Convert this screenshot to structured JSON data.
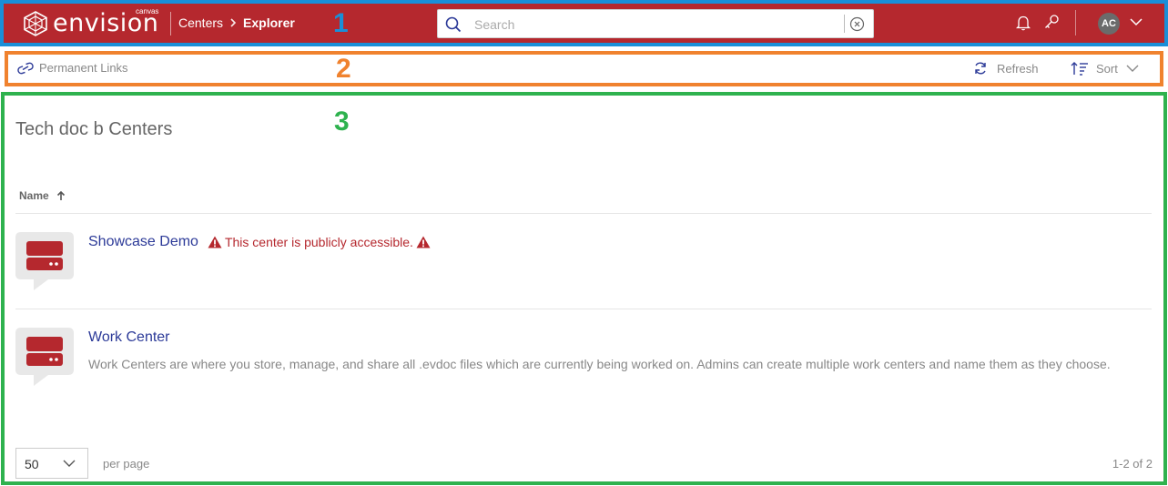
{
  "header": {
    "logo_text": "envision",
    "logo_sub": "canvas",
    "breadcrumb": {
      "parent": "Centers",
      "current": "Explorer"
    },
    "search_placeholder": "Search",
    "user_initials": "AC"
  },
  "annotations": {
    "region1": "1",
    "region2": "2",
    "region3": "3"
  },
  "toolbar": {
    "permanent_links_label": "Permanent Links",
    "refresh_label": "Refresh",
    "sort_label": "Sort"
  },
  "main": {
    "title": "Tech doc b Centers",
    "column_header": "Name",
    "centers": [
      {
        "name": "Showcase Demo",
        "warning": "This center is publicly accessible.",
        "description": ""
      },
      {
        "name": "Work Center",
        "warning": "",
        "description": "Work Centers are where you store, manage, and share all .evdoc files which are currently being worked on. Admins can create multiple work centers and name them as they choose."
      }
    ],
    "pagination": {
      "per_page_value": "50",
      "per_page_label": "per page",
      "range": "1-2 of 2"
    }
  },
  "colors": {
    "brand": "#b5282e",
    "link": "#2c3a98",
    "region1": "#1a8fd8",
    "region2": "#f0822e",
    "region3": "#2eb24e"
  }
}
